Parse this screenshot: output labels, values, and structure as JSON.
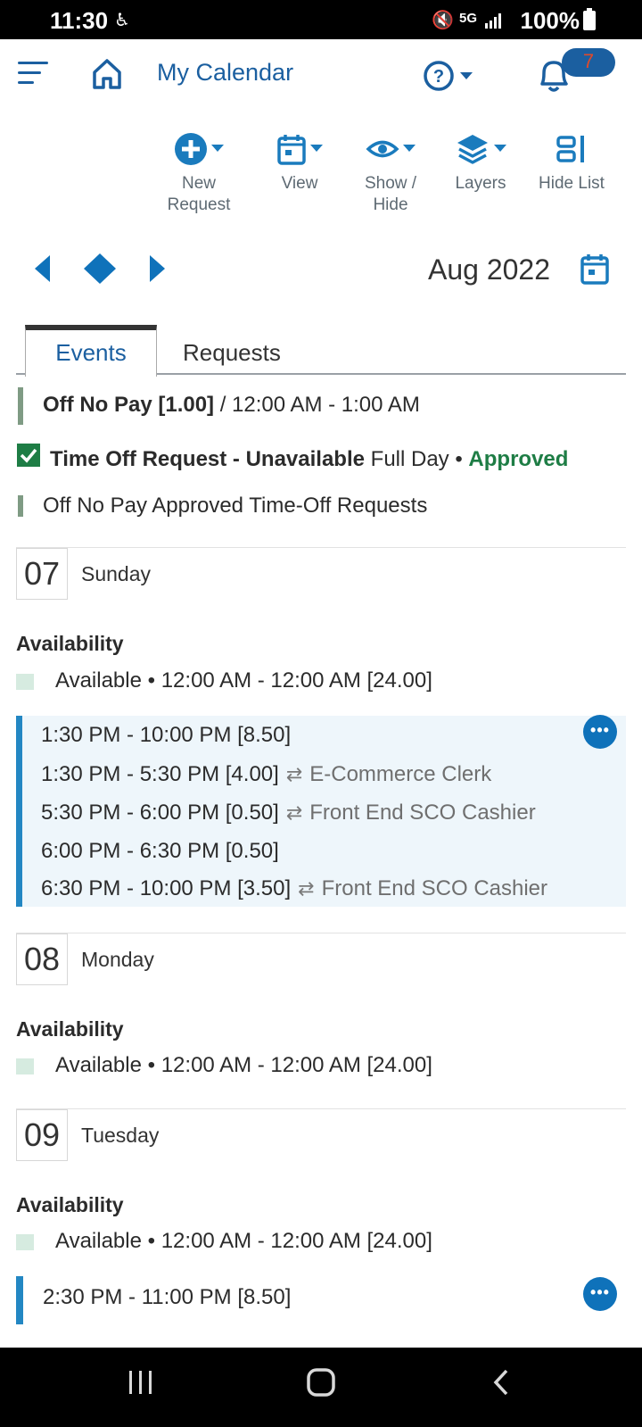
{
  "status_bar": {
    "time": "11:30",
    "battery": "100%"
  },
  "header": {
    "title": "My Calendar",
    "notification_count": "7"
  },
  "toolbar": {
    "new_request": "New\nRequest",
    "view": "View",
    "show_hide": "Show /\nHide",
    "layers": "Layers",
    "hide_list": "Hide List"
  },
  "nav": {
    "month": "Aug 2022"
  },
  "tabs": {
    "events": "Events",
    "requests": "Requests"
  },
  "legend": {
    "off_no_pay_bold": "Off No Pay [1.00]",
    "off_no_pay_time": " / 12:00 AM - 1:00 AM",
    "tor_bold": "Time Off Request - Unavailable",
    "tor_detail": " Full Day • ",
    "tor_status": "Approved",
    "off_no_pay_approved": "Off No Pay Approved Time-Off Requests"
  },
  "days": [
    {
      "date": "07",
      "name": "Sunday",
      "availability_title": "Availability",
      "availability": "Available • 12:00 AM - 12:00 AM [24.00]",
      "shift": {
        "total": "1:30 PM - 10:00 PM [8.50]",
        "segments": [
          {
            "time": "1:30 PM - 5:30 PM [4.00]",
            "role": "E-Commerce Clerk"
          },
          {
            "time": "5:30 PM - 6:00 PM [0.50]",
            "role": "Front End SCO Cashier"
          },
          {
            "time": "6:00 PM - 6:30 PM [0.50]",
            "role": ""
          },
          {
            "time": "6:30 PM - 10:00 PM [3.50]",
            "role": "Front End SCO Cashier"
          }
        ]
      }
    },
    {
      "date": "08",
      "name": "Monday",
      "availability_title": "Availability",
      "availability": "Available • 12:00 AM - 12:00 AM [24.00]"
    },
    {
      "date": "09",
      "name": "Tuesday",
      "availability_title": "Availability",
      "availability": "Available • 12:00 AM - 12:00 AM [24.00]",
      "shift": {
        "total": "2:30 PM - 11:00 PM [8.50]"
      }
    }
  ],
  "colors": {
    "brand_blue": "#1b5fa0",
    "accent_blue": "#1a7bbd",
    "approved_green": "#1e7d45"
  }
}
